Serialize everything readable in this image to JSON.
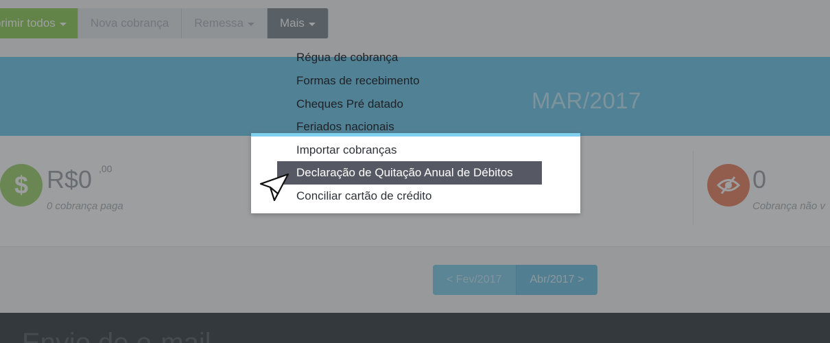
{
  "toolbar": {
    "print_all": "primir todos",
    "new_charge": "Nova cobrança",
    "remittance": "Remessa",
    "more": "Mais"
  },
  "banner": {
    "title": "MAR/2017"
  },
  "stats": {
    "paid": {
      "value": "R$0",
      "cents": ",00",
      "label": "0 cobrança paga"
    },
    "unviewed": {
      "value": "0",
      "label": "Cobrança não v"
    }
  },
  "pagination": {
    "prev": "< Fev/2017",
    "next": "Abr/2017 >"
  },
  "footer": {
    "title": "Envio de e-mail"
  },
  "dropdown": {
    "items": [
      "Régua de cobrança",
      "Formas de recebimento",
      "Cheques Pré datado",
      "Feriados nacionais",
      "Importar cobranças",
      "Declaração de Quitação Anual de Débitos",
      "Conciliar cartão de crédito"
    ],
    "selected_index": 5
  },
  "colors": {
    "accent_blue": "#7fcdec",
    "green": "#9ed36a",
    "red": "#ef8f73",
    "selected_item": "#565964"
  },
  "icons": {
    "paid": "dollar-icon",
    "unviewed": "eye-slash-icon",
    "cursor": "pointer-cursor-icon"
  }
}
